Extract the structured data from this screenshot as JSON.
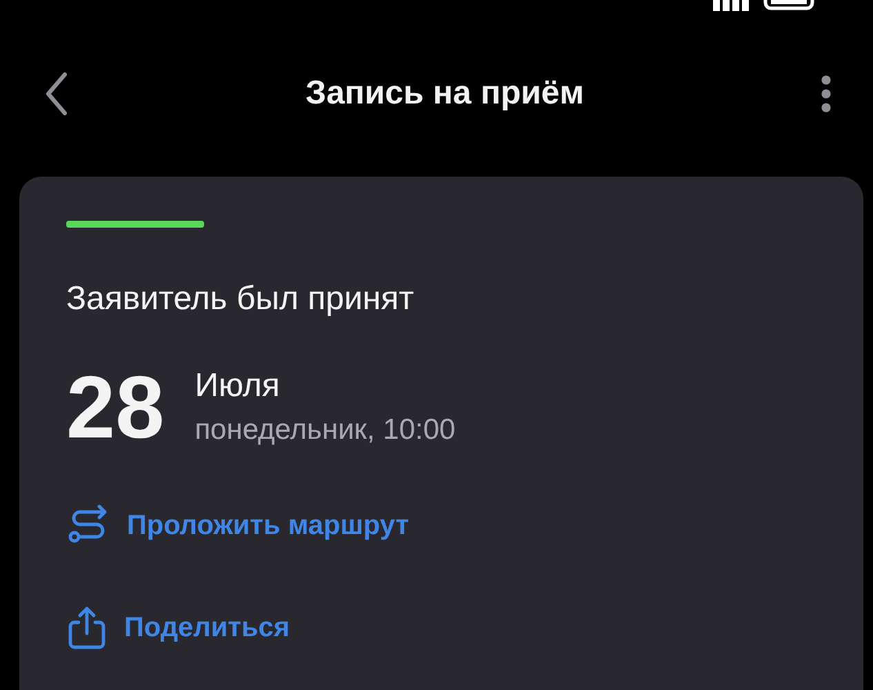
{
  "header": {
    "title": "Запись на приём"
  },
  "appointment": {
    "status": {
      "kind": "accepted",
      "text": "Заявитель был принят"
    },
    "day": "28",
    "month": "Июля",
    "weekday_time": "понедельник, 10:00"
  },
  "actions": [
    {
      "kind": "route",
      "label": "Проложить маршрут"
    },
    {
      "kind": "share",
      "label": "Поделиться"
    }
  ]
}
